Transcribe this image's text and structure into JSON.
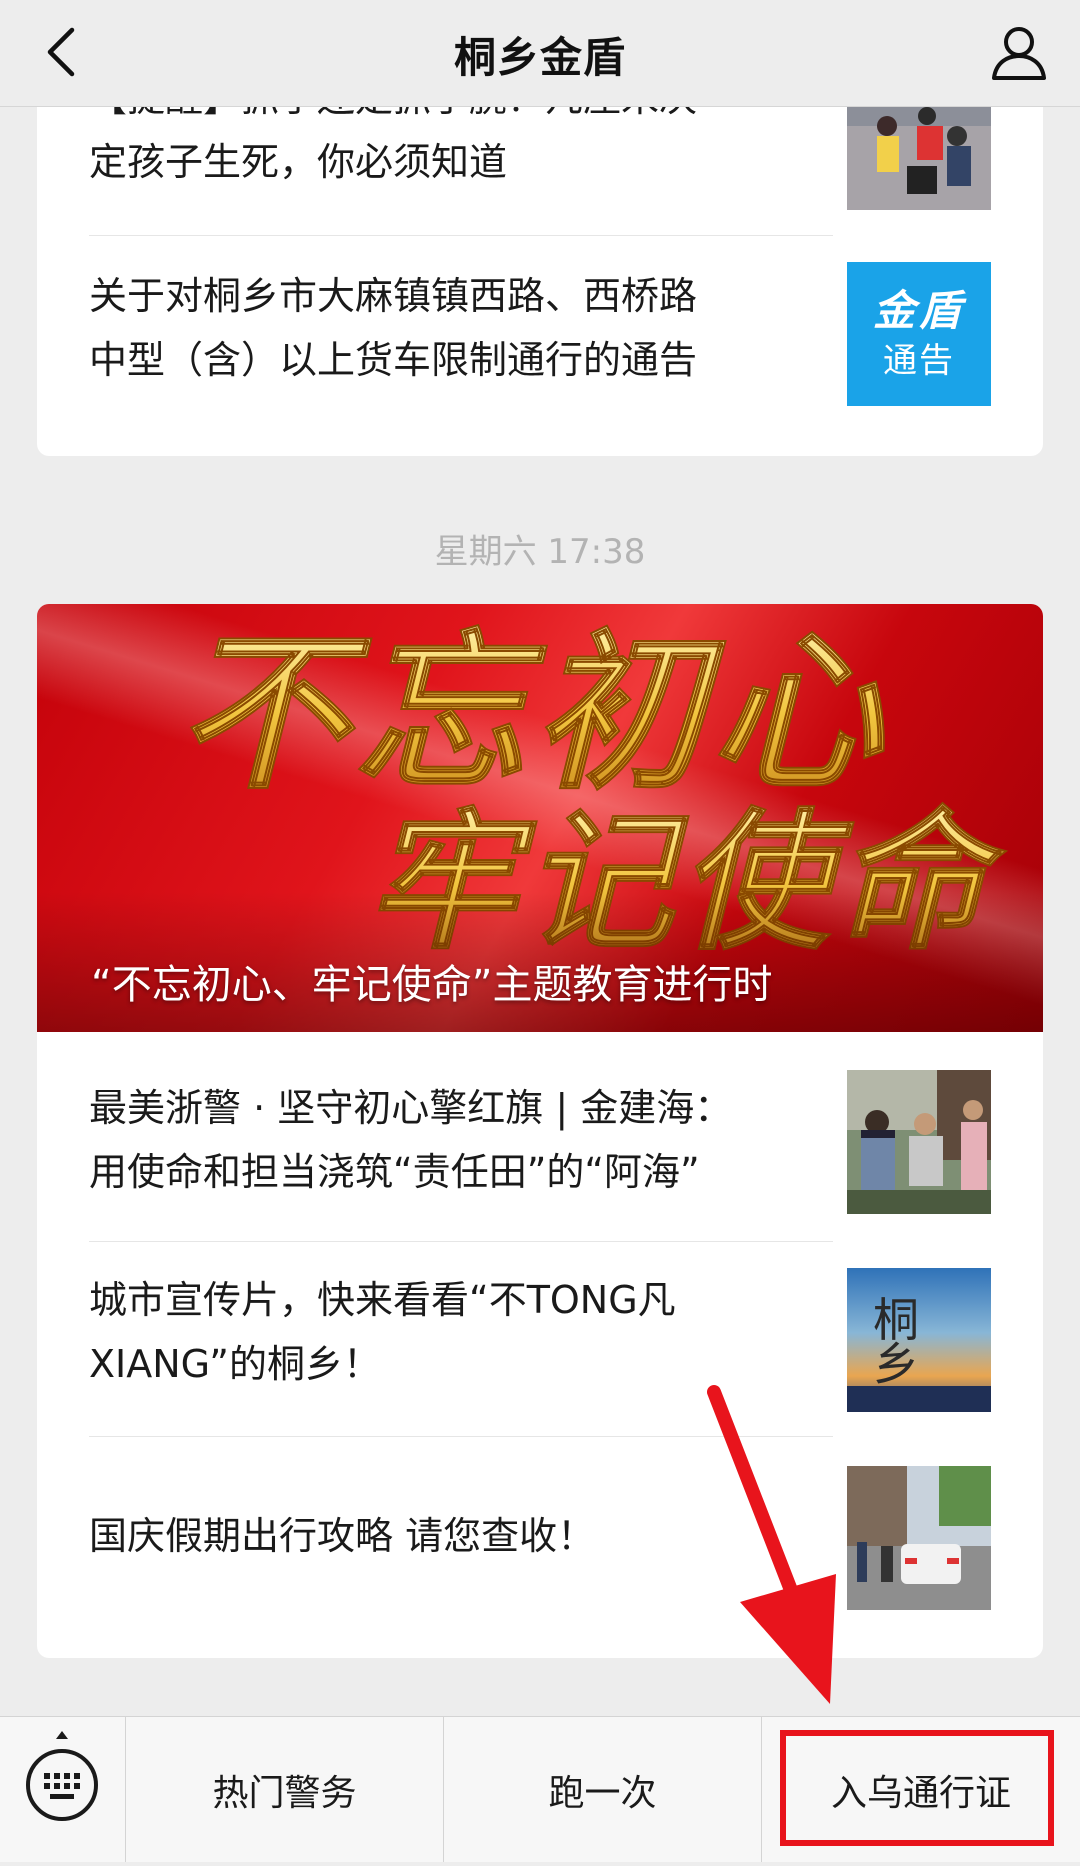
{
  "header": {
    "title": "桐乡金盾",
    "back_icon": "chevron-left-icon",
    "profile_icon": "user-icon"
  },
  "feed": {
    "group1": {
      "articles": [
        {
          "title_line1": "【提醒】抓手还是抓手腕？几厘米决",
          "title_line2": "定孩子生死，你必须知道",
          "thumb": "children-street-photo"
        },
        {
          "title_line1": "关于对桐乡市大麻镇镇西路、西桥路",
          "title_line2": "中型（含）以上货车限制通行的通告",
          "thumb": "notice-logo",
          "thumb_text_top": "金盾",
          "thumb_text_bottom": "通告"
        }
      ]
    },
    "timestamp": "星期六 17:38",
    "group2": {
      "hero": {
        "calligraphy_line1": "不忘初心",
        "calligraphy_line2": "牢记使命",
        "caption": "“不忘初心、牢记使命”主题教育进行时"
      },
      "articles": [
        {
          "title_line1": "最美浙警 · 坚守初心擎红旗 | 金建海：",
          "title_line2": "用使命和担当浇筑“责任田”的“阿海”",
          "thumb": "police-with-elders-photo"
        },
        {
          "title_line1": "城市宣传片，快来看看“不TONG凡",
          "title_line2": "XIANG”的桐乡！",
          "thumb": "tongxiang-promo-image",
          "thumb_text": "桐乡"
        },
        {
          "title_line1": "国庆假期出行攻略 请您查收！",
          "title_line2": "",
          "thumb": "traffic-street-photo"
        }
      ]
    }
  },
  "bottom_menu": {
    "keyboard_icon": "keyboard-icon",
    "items": [
      {
        "label": "热门警务"
      },
      {
        "label": "跑一次"
      },
      {
        "label": "入乌通行证"
      }
    ]
  },
  "annotation": {
    "color": "#e8141c",
    "arrow_icon": "red-arrow-icon"
  }
}
